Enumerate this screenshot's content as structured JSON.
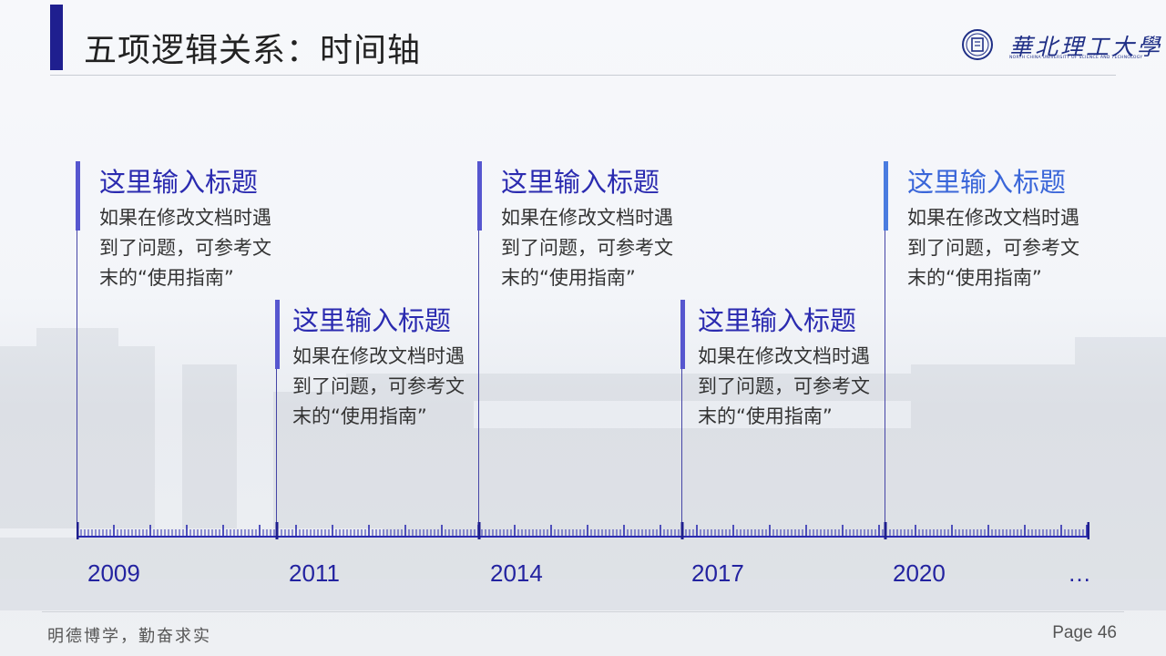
{
  "header": {
    "title": "五项逻辑关系：时间轴",
    "logo_text": "華北理工大學",
    "logo_subtitle": "NORTH CHINA UNIVERSITY OF SCIENCE AND TECHNOLOGY"
  },
  "events": [
    {
      "title": "这里输入标题",
      "body": "如果在修改文档时遇到了问题，可参考文末的“使用指南”",
      "year": "2009",
      "color": "#2b2bb0"
    },
    {
      "title": "这里输入标题",
      "body": "如果在修改文档时遇到了问题，可参考文末的“使用指南”",
      "year": "2011",
      "color": "#2b2bb0"
    },
    {
      "title": "这里输入标题",
      "body": "如果在修改文档时遇到了问题，可参考文末的“使用指南”",
      "year": "2014",
      "color": "#2b2bb0"
    },
    {
      "title": "这里输入标题",
      "body": "如果在修改文档时遇到了问题，可参考文末的“使用指南”",
      "year": "2017",
      "color": "#2b2bb0"
    },
    {
      "title": "这里输入标题",
      "body": "如果在修改文档时遇到了问题，可参考文末的“使用指南”",
      "year": "2020",
      "color": "#3a66d9"
    }
  ],
  "axis_end": "…",
  "footer": {
    "motto": "明德博学，勤奋求实",
    "page": "Page 46"
  },
  "colors": {
    "accent": "#1f1f8f",
    "bar": "#5656cf",
    "bar_last": "#4a7ce0"
  }
}
